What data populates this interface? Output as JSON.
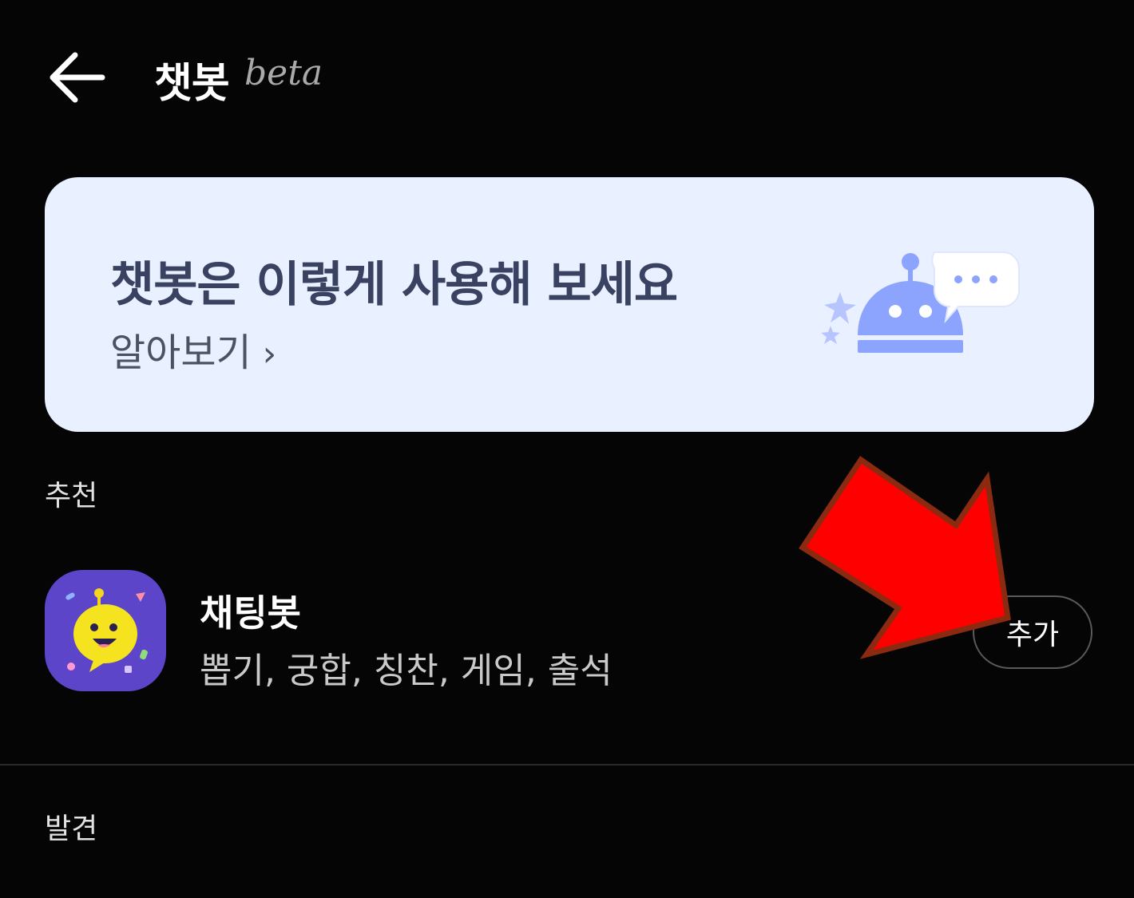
{
  "header": {
    "title": "챗봇",
    "badge": "beta",
    "back_icon": "arrow-left-icon"
  },
  "banner": {
    "title": "챗봇은 이렇게 사용해 보세요",
    "link_label": "알아보기",
    "link_chevron": "›",
    "illustration": "robot-speech-bubble-icon"
  },
  "sections": {
    "recommend_label": "추천",
    "discover_label": "발견"
  },
  "recommended": [
    {
      "name": "채팅봇",
      "tags": "뽑기, 궁합, 칭찬, 게임, 출석",
      "action_label": "추가",
      "icon": "chatting-bot-icon"
    }
  ],
  "overlay": {
    "annotation_icon": "red-arrow-icon",
    "color": "#ff0000"
  },
  "colors": {
    "background": "#050505",
    "banner_bg": "#e9f0ff",
    "bot_icon_bg": "#5c45c9",
    "robot_blue": "#8da4ff"
  }
}
